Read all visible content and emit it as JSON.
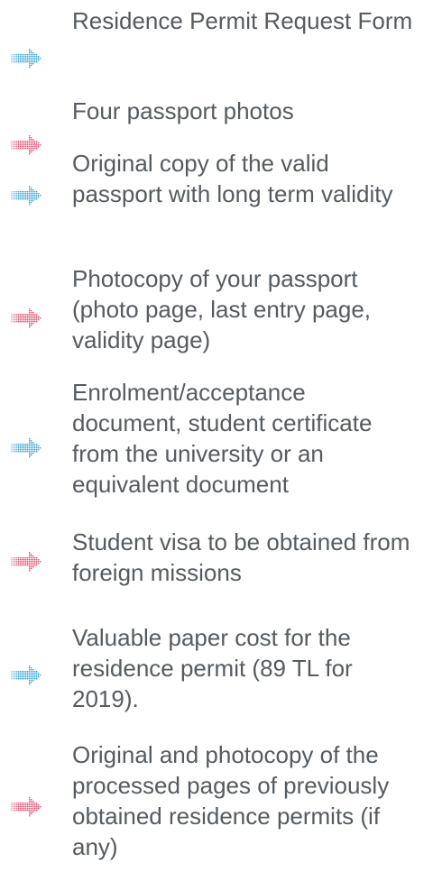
{
  "colors": {
    "text": "#555b61",
    "arrow_blue": "#3aa6d6",
    "arrow_pink": "#e2506e"
  },
  "requirements": [
    {
      "text": "Residence Permit Request Form",
      "icon": "dotted-arrow-right-icon",
      "color": "blue"
    },
    {
      "text": "Four passport photos",
      "icon": "dotted-arrow-right-icon",
      "color": "pink"
    },
    {
      "text": "Original copy of the valid passport with long term validity",
      "icon": "dotted-arrow-right-icon",
      "color": "blue"
    },
    {
      "text": "Photocopy of your passport (photo page, last entry page, validity page)",
      "icon": "dotted-arrow-right-icon",
      "color": "pink"
    },
    {
      "text": "Enrolment/acceptance document, student certificate from the university or an equivalent document",
      "icon": "dotted-arrow-right-icon",
      "color": "blue"
    },
    {
      "text": "Student visa to be obtained from foreign missions",
      "icon": "dotted-arrow-right-icon",
      "color": "pink"
    },
    {
      "text": "Valuable paper cost for the residence permit (89 TL for 2019).",
      "icon": "dotted-arrow-right-icon",
      "color": "blue"
    },
    {
      "text": "Original and photocopy of the processed pages of previously obtained residence permits (if any)",
      "icon": "dotted-arrow-right-icon",
      "color": "pink"
    }
  ]
}
